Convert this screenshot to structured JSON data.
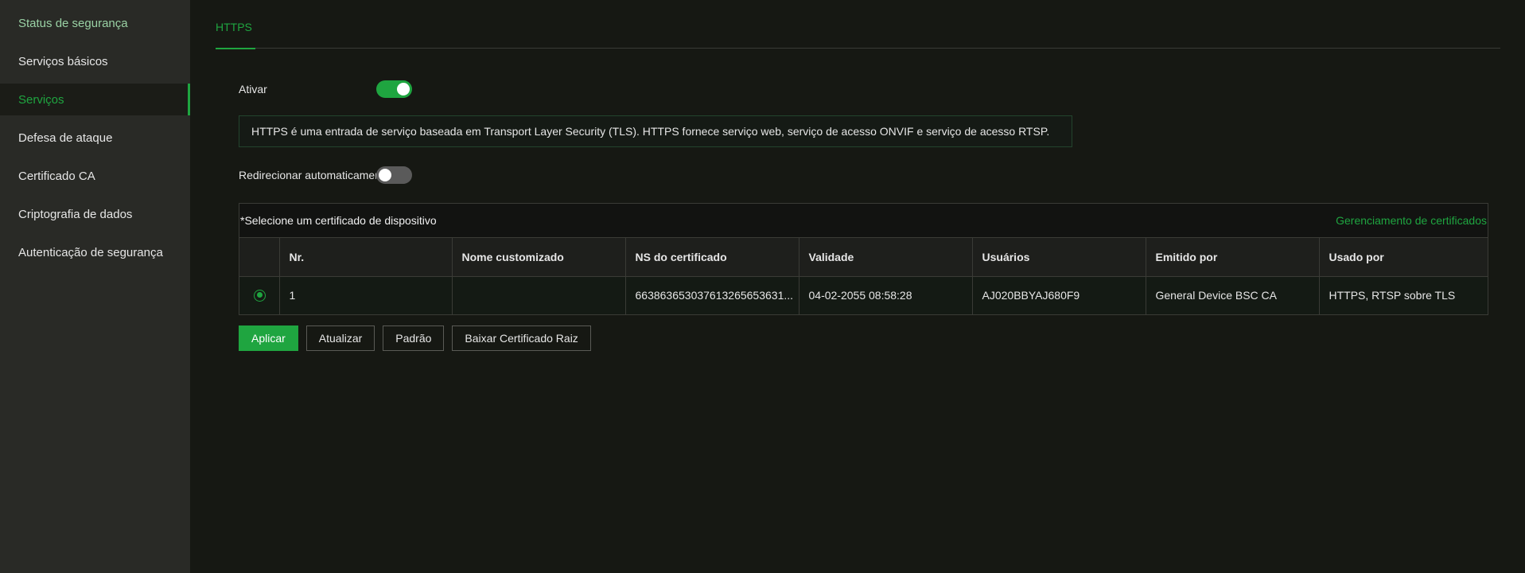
{
  "sidebar": {
    "items": [
      {
        "label": "Status de segurança"
      },
      {
        "label": "Serviços básicos"
      },
      {
        "label": "Serviços"
      },
      {
        "label": "Defesa de ataque"
      },
      {
        "label": "Certificado CA"
      },
      {
        "label": "Criptografia de dados"
      },
      {
        "label": "Autenticação de segurança"
      }
    ],
    "active_index": 2
  },
  "tabs": [
    {
      "label": "HTTPS"
    }
  ],
  "https": {
    "enable_label": "Ativar",
    "enable_state": true,
    "info_text": "HTTPS é uma entrada de serviço baseada em Transport Layer Security (TLS). HTTPS fornece serviço web, serviço de acesso ONVIF e serviço de acesso RTSP.",
    "redirect_label": "Redirecionar automaticamente para HTTPS",
    "redirect_state": false
  },
  "certificates": {
    "title": "*Selecione um certificado de dispositivo",
    "manage_link": "Gerenciamento de certificados",
    "columns": [
      "",
      "Nr.",
      "Nome customizado",
      "NS do certificado",
      "Validade",
      "Usuários",
      "Emitido por",
      "Usado por"
    ],
    "rows": [
      {
        "selected": true,
        "nr": "1",
        "custom_name": "",
        "serial": "663863653037613265653631...",
        "validity": "04-02-2055 08:58:28",
        "users": "AJ020BBYAJ680F9",
        "issued_by": "General Device BSC CA",
        "used_by": "HTTPS, RTSP sobre TLS"
      }
    ]
  },
  "buttons": {
    "apply": "Aplicar",
    "refresh": "Atualizar",
    "default": "Padrão",
    "download_root": "Baixar Certificado Raiz"
  },
  "colors": {
    "accent": "#1fa540",
    "sidebar_bg": "#292a26",
    "page_bg": "#161813"
  }
}
